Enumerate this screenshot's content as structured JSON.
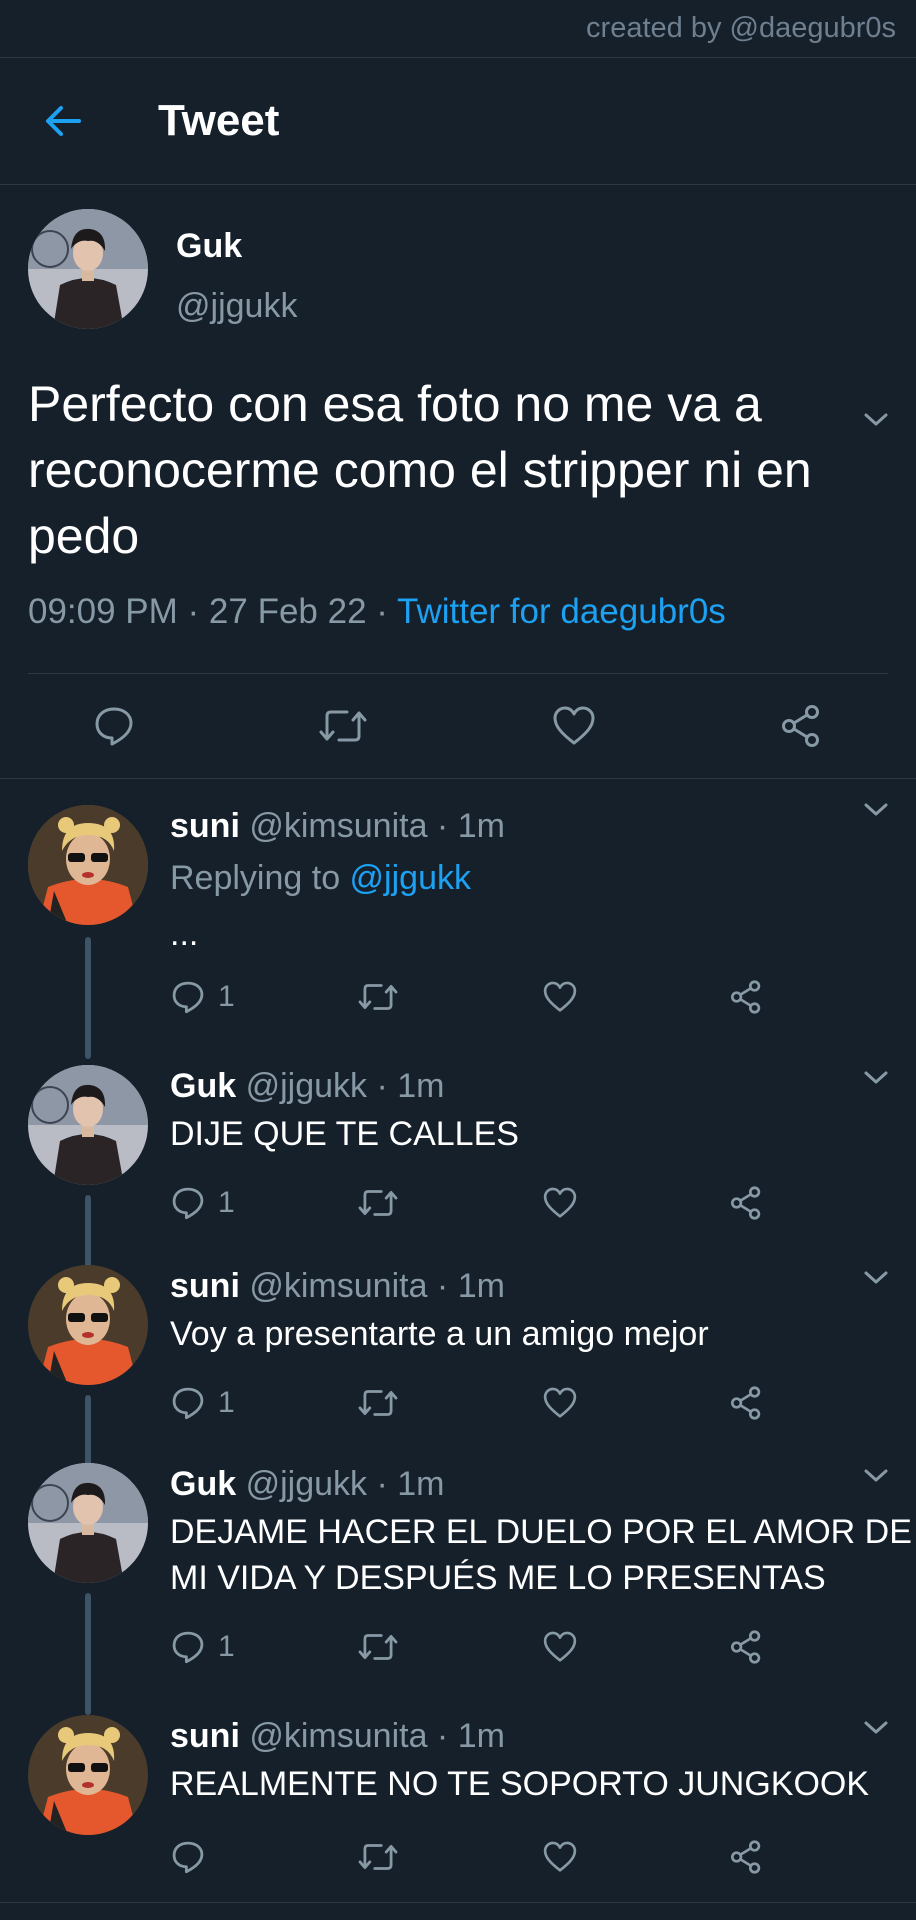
{
  "watermark": "created by @daegubr0s",
  "header": {
    "title": "Tweet"
  },
  "main_tweet": {
    "name": "Guk",
    "handle": "@jjgukk",
    "text": "Perfecto con esa foto no me va a reconocerme como el stripper ni en pedo",
    "time": "09:09 PM · 27 Feb 22 · ",
    "source": "Twitter for daegubr0s"
  },
  "replies": [
    {
      "name": "suni",
      "handle": "@kimsunita · 1m",
      "replying_label": "Replying to ",
      "replying_to": "@jjgukk",
      "text": "...",
      "reply_count": "1"
    },
    {
      "name": "Guk",
      "handle": "@jjgukk · 1m",
      "text": "DIJE QUE TE CALLES",
      "reply_count": "1"
    },
    {
      "name": "suni",
      "handle": "@kimsunita · 1m",
      "text": "Voy a presentarte a un amigo mejor",
      "reply_count": "1"
    },
    {
      "name": "Guk",
      "handle": "@jjgukk · 1m",
      "text": "DEJAME HACER EL DUELO POR EL AMOR DE MI VIDA Y DESPUÉS ME LO PRESENTAS",
      "reply_count": "1"
    },
    {
      "name": "suni",
      "handle": "@kimsunita · 1m",
      "text": "REALMENTE NO TE SOPORTO JUNGKOOK",
      "reply_count": ""
    }
  ],
  "icons": {
    "back": "arrow-left-icon",
    "caret": "chevron-down-icon",
    "reply": "speech-bubble-icon",
    "retweet": "retweet-icon",
    "like": "heart-icon",
    "share": "share-icon"
  },
  "colors": {
    "background": "#15202b",
    "accent": "#1da1f2",
    "muted": "#8899a6",
    "divider": "#2b3846",
    "thread": "#3d5466"
  }
}
